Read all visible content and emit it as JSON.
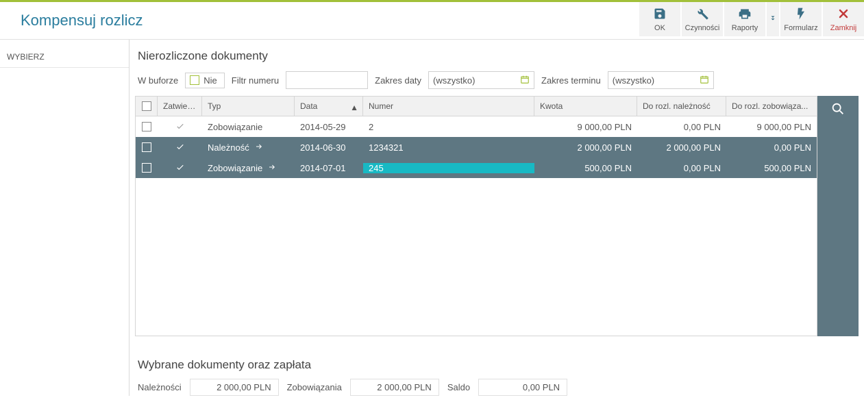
{
  "header": {
    "title": "Kompensuj rozlicz"
  },
  "toolbar": {
    "ok": "OK",
    "czynnosci": "Czynności",
    "raporty": "Raporty",
    "formularz": "Formularz",
    "zamknij": "Zamknij"
  },
  "sidebar": {
    "wybierz": "WYBIERZ"
  },
  "section": {
    "title": "Nierozliczone dokumenty"
  },
  "filters": {
    "bufor_label": "W buforze",
    "bufor_value": "Nie",
    "filtr_label": "Filtr numeru",
    "zakres_daty_label": "Zakres daty",
    "zakres_daty_value": "(wszystko)",
    "zakres_terminu_label": "Zakres terminu",
    "zakres_terminu_value": "(wszystko)"
  },
  "grid": {
    "headers": {
      "zatw": "Zatwier...",
      "typ": "Typ",
      "data": "Data",
      "numer": "Numer",
      "kwota": "Kwota",
      "rozl_n": "Do rozl. należność",
      "rozl_z": "Do rozl. zobowiąza..."
    },
    "rows": [
      {
        "sel": false,
        "zatw": "✓",
        "typ": "Zobowiązanie",
        "arrow": false,
        "data": "2014-05-29",
        "numer": "2",
        "num_hl": false,
        "kwota": "9 000,00 PLN",
        "rozl_n": "0,00 PLN",
        "rozl_z": "9 000,00 PLN",
        "style": "light",
        "zatw_style": "gray"
      },
      {
        "sel": false,
        "zatw": "✓",
        "typ": "Należność",
        "arrow": true,
        "data": "2014-06-30",
        "numer": "1234321",
        "num_hl": false,
        "kwota": "2 000,00 PLN",
        "rozl_n": "2 000,00 PLN",
        "rozl_z": "0,00 PLN",
        "style": "dark",
        "zatw_style": "white"
      },
      {
        "sel": false,
        "zatw": "✓",
        "typ": "Zobowiązanie",
        "arrow": true,
        "data": "2014-07-01",
        "numer": "245",
        "num_hl": true,
        "kwota": "500,00 PLN",
        "rozl_n": "0,00 PLN",
        "rozl_z": "500,00 PLN",
        "style": "dark",
        "zatw_style": "white"
      }
    ]
  },
  "bottom": {
    "title": "Wybrane dokumenty oraz zapłata",
    "naleznosci_label": "Należności",
    "naleznosci_value": "2 000,00 PLN",
    "zobowiazania_label": "Zobowiązania",
    "zobowiazania_value": "2 000,00 PLN",
    "saldo_label": "Saldo",
    "saldo_value": "0,00 PLN"
  }
}
